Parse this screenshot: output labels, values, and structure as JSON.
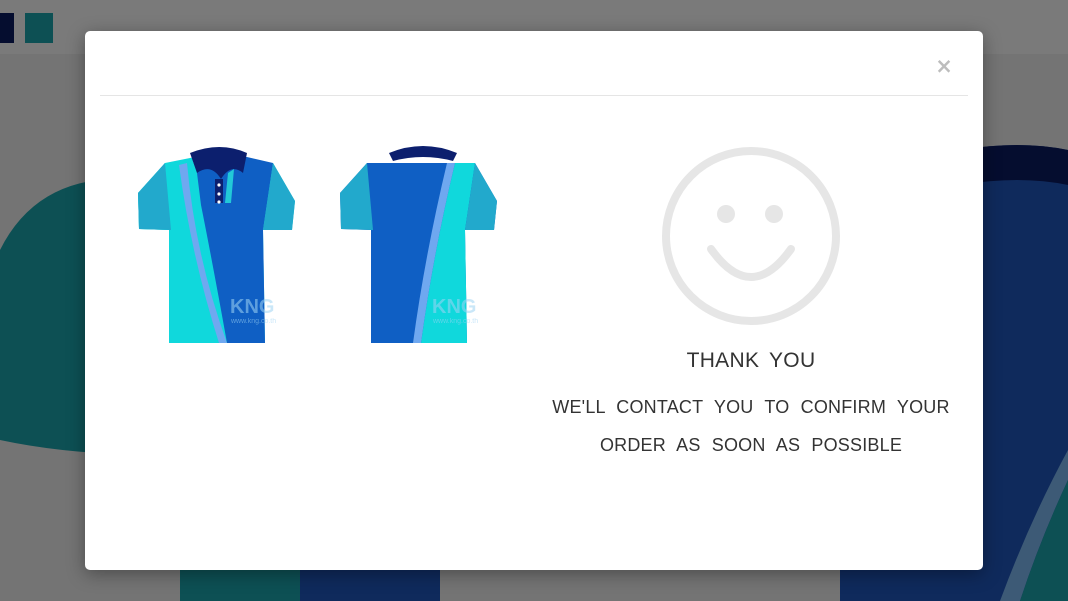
{
  "page": {
    "background_colors": {
      "navy": "#0b1a5e",
      "teal": "#1aa0a8",
      "royal_blue": "#1f55b8"
    }
  },
  "modal": {
    "close_label": "×",
    "product_images": [
      {
        "view": "front",
        "watermark": "KNG",
        "watermark_url": "www.kng.co.th"
      },
      {
        "view": "back",
        "watermark": "KNG",
        "watermark_url": "www.kng.co.th"
      }
    ],
    "confirmation": {
      "icon": "smiley-face-icon",
      "title": "THANK YOU",
      "message_line1": "WE'LL CONTACT YOU TO CONFIRM YOUR",
      "message_line2": "ORDER AS SOON AS POSSIBLE"
    },
    "colors": {
      "collar_navy": "#0c1f6e",
      "body_blue": "#0f5fc4",
      "panel_cyan": "#10d8dc",
      "sleeve_teal": "#22a9cc",
      "piping_lightblue": "#6fa8f0",
      "smiley_gray": "#e6e6e6"
    }
  }
}
